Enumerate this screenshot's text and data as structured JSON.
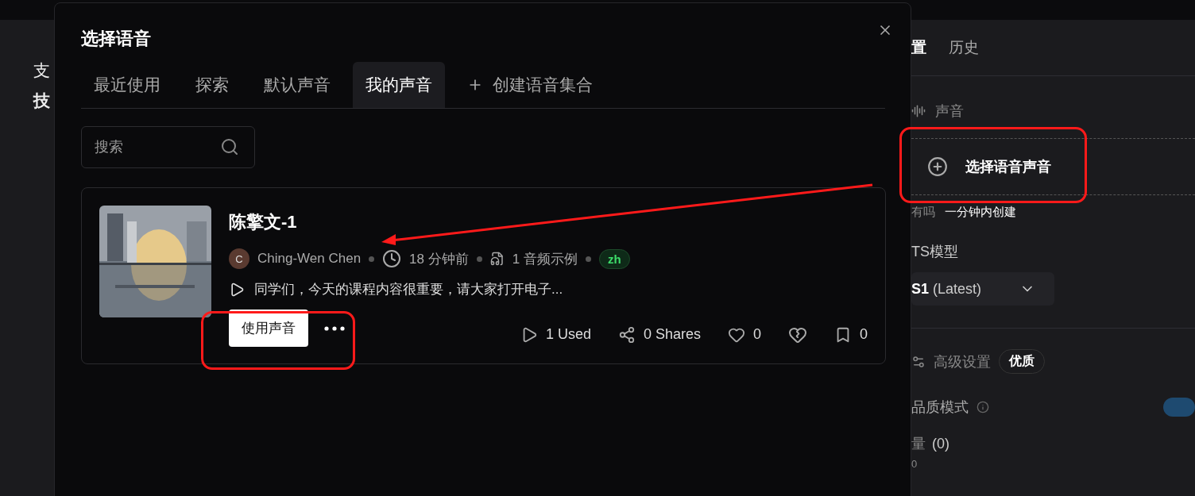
{
  "background_page": {
    "left_text": [
      "支",
      "技"
    ],
    "right_panel": {
      "tabs": [
        {
          "label": "置",
          "selected": true
        },
        {
          "label": "历史",
          "selected": false
        }
      ],
      "voice_section": {
        "label": "声音",
        "select_button": "选择语音声音",
        "hint": "有吗",
        "create_link": "一分钟内创建"
      },
      "model": {
        "label": "TS模型",
        "value": "S1",
        "version": "(Latest)"
      },
      "advanced": {
        "label": "高级设置",
        "badge": "优质"
      },
      "quality_mode": {
        "label": "品质模式",
        "on": true
      },
      "amount": {
        "label": "量",
        "value": "(0)",
        "reading": "0"
      }
    }
  },
  "dialog": {
    "title": "选择语音",
    "tabs": [
      {
        "label": "最近使用",
        "selected": false
      },
      {
        "label": "探索",
        "selected": false
      },
      {
        "label": "默认声音",
        "selected": false
      },
      {
        "label": "我的声音",
        "selected": true
      },
      {
        "label": "创建语音集合",
        "selected": false,
        "kind": "add"
      }
    ],
    "search": {
      "placeholder": "搜索"
    },
    "voices": [
      {
        "name": "陈擎文-1",
        "avatar_letter": "C",
        "author": "Ching-Wen Chen",
        "time": "18 分钟前",
        "samples": "1 音频示例",
        "language": "zh",
        "sample_text": "同学们，今天的课程内容很重要，请大家打开电子...",
        "use_button": "使用声音",
        "used": "1 Used",
        "shares": "0 Shares",
        "likes": "0",
        "saves": "0"
      }
    ]
  }
}
